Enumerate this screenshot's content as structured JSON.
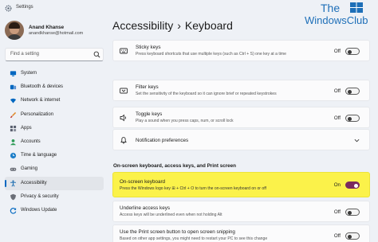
{
  "window": {
    "title": "Settings"
  },
  "watermark": {
    "line1": "The",
    "line2": "WindowsClub"
  },
  "user": {
    "name": "Anand Khanse",
    "email": "anandkhanse@hotmail.com"
  },
  "search": {
    "placeholder": "Find a setting"
  },
  "nav": {
    "items": [
      {
        "label": "System",
        "icon": "monitor-icon",
        "color": "#0067c0"
      },
      {
        "label": "Bluetooth & devices",
        "icon": "bluetooth-icon",
        "color": "#0067c0"
      },
      {
        "label": "Network & internet",
        "icon": "wifi-icon",
        "color": "#0067c0"
      },
      {
        "label": "Personalization",
        "icon": "brush-icon",
        "color": "#e08a2a"
      },
      {
        "label": "Apps",
        "icon": "apps-icon",
        "color": "#5a6170"
      },
      {
        "label": "Accounts",
        "icon": "person-icon",
        "color": "#2f9c58"
      },
      {
        "label": "Time & language",
        "icon": "globe-clock-icon",
        "color": "#1e7fc8"
      },
      {
        "label": "Gaming",
        "icon": "gamepad-icon",
        "color": "#6b6f78"
      },
      {
        "label": "Accessibility",
        "icon": "accessibility-icon",
        "color": "#1f6fb2",
        "active": true
      },
      {
        "label": "Privacy & security",
        "icon": "shield-icon",
        "color": "#6b6f78"
      },
      {
        "label": "Windows Update",
        "icon": "update-icon",
        "color": "#0067c0"
      }
    ]
  },
  "breadcrumb": {
    "parent": "Accessibility",
    "separator": "›",
    "current": "Keyboard"
  },
  "settings": {
    "sticky": {
      "title": "Sticky keys",
      "desc": "Press keyboard shortcuts that use multiple keys (such as Ctrl + S) one key at a time",
      "state": "Off"
    },
    "filter": {
      "title": "Filter keys",
      "desc": "Set the sensitivity of the keyboard so it can ignore brief or repeated keystrokes",
      "state": "Off"
    },
    "toggle": {
      "title": "Toggle keys",
      "desc": "Play a sound when you press caps, num, or scroll lock",
      "state": "Off"
    },
    "notifications": {
      "title": "Notification preferences"
    },
    "section_title": "On-screen keyboard, access keys, and Print screen",
    "osk": {
      "title": "On-screen keyboard",
      "desc": "Press the Windows logo key ⊞ + Ctrl + O to turn the on-screen keyboard on or off",
      "state": "On"
    },
    "underline": {
      "title": "Underline access keys",
      "desc": "Access keys will be underlined even when not holding Alt",
      "state": "Off"
    },
    "printscreen": {
      "title": "Use the Print screen button to open screen snipping",
      "desc": "Based on other app settings, you might need to restart your PC to see this change",
      "state": "Off"
    }
  },
  "colors": {
    "accent": "#0067c0",
    "toggle_on": "#7a2a5e",
    "highlight": "#fbf24a"
  }
}
